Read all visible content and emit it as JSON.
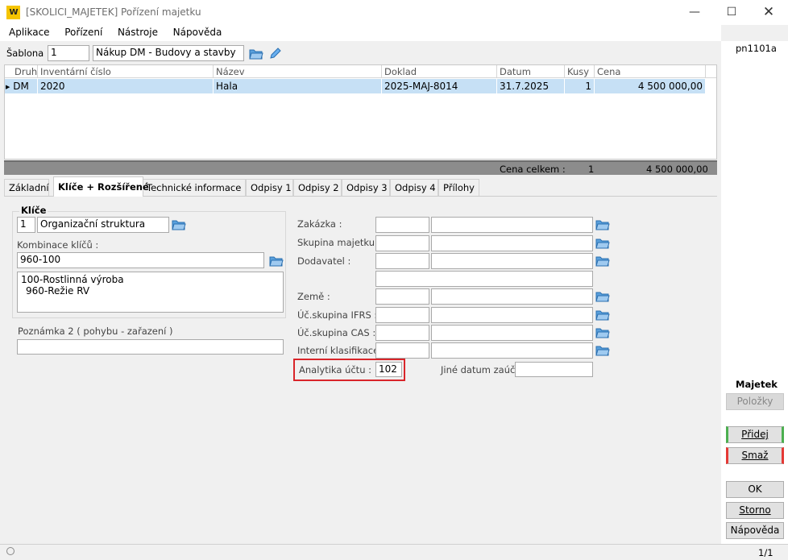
{
  "window": {
    "title": "[SKOLICI_MAJETEK] Pořízení majetku",
    "logo_text": "W"
  },
  "menu": [
    "Aplikace",
    "Pořízení",
    "Nástroje",
    "Nápověda"
  ],
  "sablona": {
    "label": "Šablona :",
    "number": "1",
    "name": "Nákup DM - Budovy a stavby"
  },
  "grid": {
    "headers": [
      "Druh",
      "Inventární číslo",
      "Název",
      "Doklad",
      "Datum",
      "Kusy",
      "Cena"
    ],
    "row": {
      "druh": "DM",
      "inv": "2020",
      "nazev": "Hala",
      "doklad": "2025-MAJ-8014",
      "datum": "31.7.2025",
      "kusy": "1",
      "cena": "4 500 000,00"
    },
    "footer": {
      "label": "Cena celkem :",
      "kusy": "1",
      "cena": "4 500 000,00"
    }
  },
  "tabs": [
    "Základní",
    "Klíče + Rozšířené",
    "Technické informace",
    "Odpisy 1",
    "Odpisy 2",
    "Odpisy 3",
    "Odpisy 4",
    "Přílohy"
  ],
  "keys": {
    "group_title": "Klíče",
    "org_number": "1",
    "org_name": "Organizační struktura",
    "combo_label": "Kombinace klíčů :",
    "combo_value": "960-100",
    "combo_lines": [
      "100-Rostlinná výroba",
      "960-Režie RV"
    ],
    "note_label": "Poznámka 2 ( pohybu - zařazení )",
    "note_value": ""
  },
  "right_fields": {
    "zakazka": "Zakázka :",
    "skupina": "Skupina majetku :",
    "dodavatel": "Dodavatel :",
    "zeme": "Země :",
    "ifrs": "Úč.skupina IFRS :",
    "cas": "Úč.skupina CAS :",
    "interni": "Interní klasifikace :",
    "analytika_label": "Analytika účtu :",
    "analytika_value": "102",
    "jine_label": "Jiné datum zaúčt. :"
  },
  "side": {
    "code": "pn1101a",
    "section": "Majetek",
    "polozky": "Položky",
    "pridej": "Přidej",
    "smaz": "Smaž",
    "ok": "OK",
    "storno": "Storno",
    "napoveda": "Nápověda"
  },
  "status": {
    "page": "1/1"
  },
  "colors": {
    "selection": "#c6e0f5",
    "highlight": "#d9252a",
    "add": "#4caf50",
    "delete": "#e53935"
  }
}
